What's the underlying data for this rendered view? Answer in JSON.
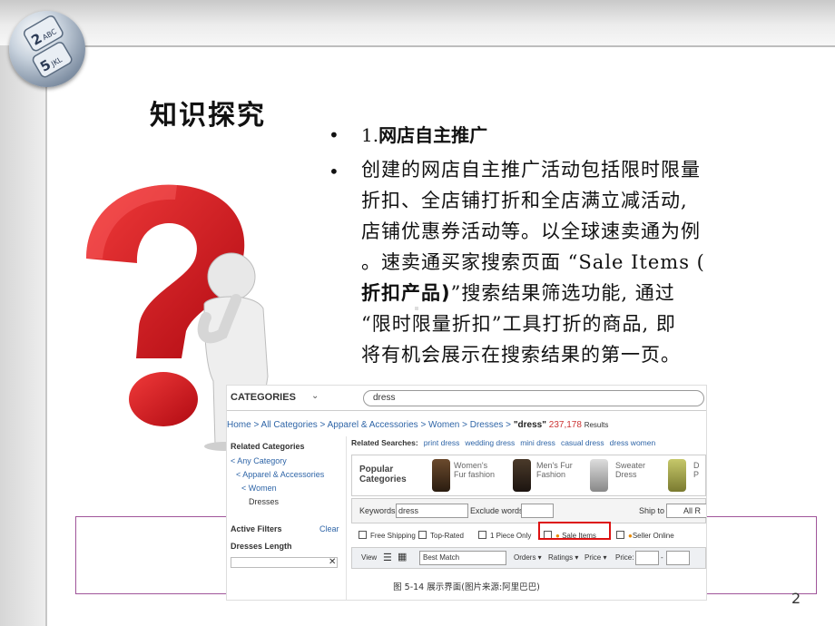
{
  "slide": {
    "title": "知识探究",
    "page_number": "2",
    "logo_keys": [
      "2",
      "ABC",
      "5",
      "JKL"
    ]
  },
  "bullets": {
    "b1_num": "1.",
    "b1_text": "网店自主推广",
    "b2_line1": "创建的网店自主推广活动包括限时限量",
    "b2_line2": "折扣、全店铺打折和全店满立减活动,",
    "b2_line3": "店铺优惠券活动等。以全球速卖通为例",
    "b2_line4": "。速卖通买家搜索页面 “Sale Items (",
    "b2_line5_bold": "折扣产品)",
    "b2_line5_rest": "”搜索结果筛选功能, 通过",
    "b2_line6": "“限时限量折扣”工具打折的商品, 即",
    "b2_line7": "将有机会展示在搜索结果的第一页。"
  },
  "screenshot": {
    "categories": "CATEGORIES",
    "search_value": "dress",
    "breadcrumb": "Home > All Categories > Apparel & Accessories > Women > Dresses > ",
    "query": "\"dress\"",
    "count": "237,178",
    "results": "Results",
    "left": {
      "related_categories": "Related Categories",
      "any_category": "< Any Category",
      "apparel": "< Apparel & Accessories",
      "women": "< Women",
      "dresses": "Dresses",
      "active_filters": "Active Filters",
      "clear": "Clear",
      "dresses_length": "Dresses Length"
    },
    "related_label": "Related Searches:",
    "related_items": [
      "print dress",
      "wedding dress",
      "mini dress",
      "casual dress",
      "dress women"
    ],
    "popular_categories": "Popular Categories",
    "popular_items": [
      {
        "l1": "Women's",
        "l2": "Fur fashion"
      },
      {
        "l1": "Men's Fur",
        "l2": "Fashion"
      },
      {
        "l1": "Sweater",
        "l2": "Dress"
      },
      {
        "l1": "D",
        "l2": "P"
      }
    ],
    "keywords_label": "Keywords:",
    "keywords_value": "dress",
    "exclude_label": "Exclude words:",
    "ship_to": "Ship to",
    "all_regions": "All R",
    "filters": [
      "Free Shipping",
      "Top-Rated",
      "1 Piece Only",
      "Sale Items",
      "Seller Online"
    ],
    "view": "View",
    "best_match": "Best Match",
    "orders": "Orders",
    "ratings": "Ratings",
    "price": "Price",
    "price_label": "Price:",
    "caption": "图 5-14 展示界面(图片来源:阿里巴巴)"
  },
  "colors": {
    "link": "#2f65a7",
    "frame": "#a0559a",
    "question_mark": "#d8111a",
    "highlight": "#dd1111"
  }
}
